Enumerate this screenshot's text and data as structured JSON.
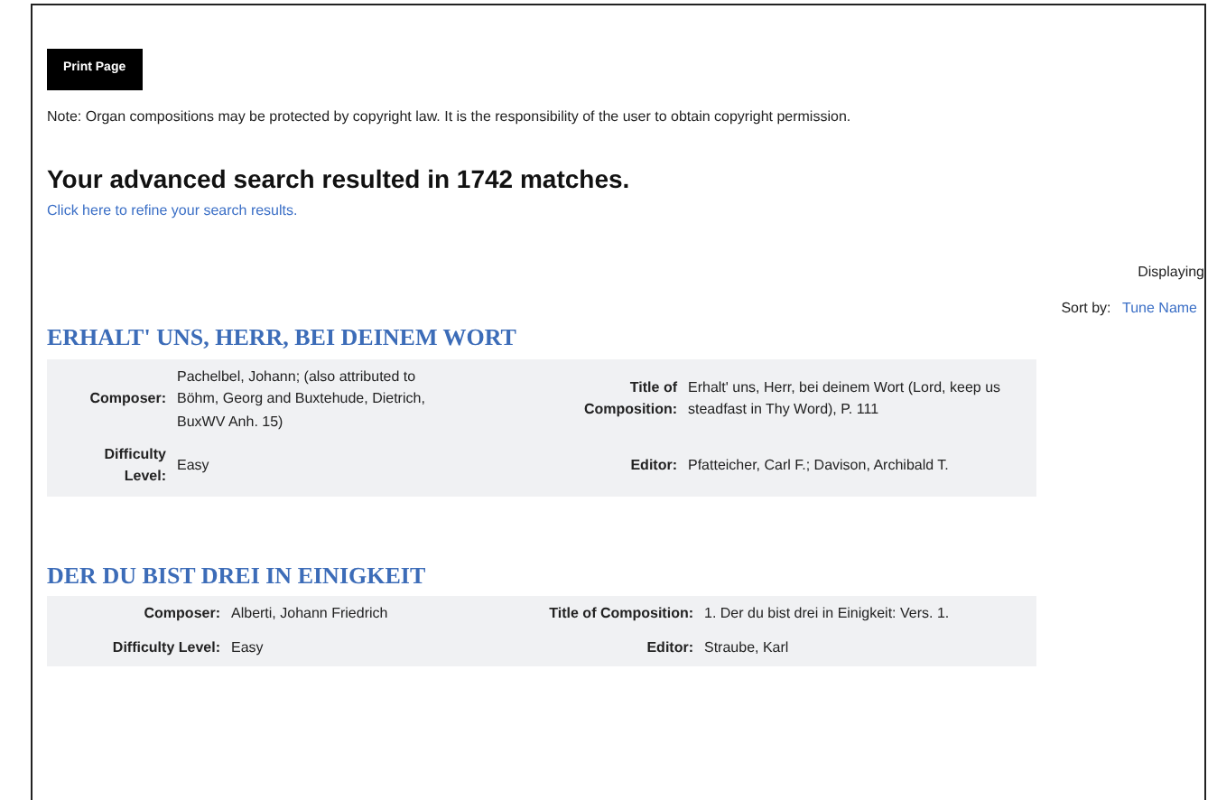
{
  "print_button": "Print Page",
  "note": "Note: Organ compositions may be protected by copyright law. It is the responsibility of the user to obtain copyright permission.",
  "results_heading": "Your advanced search resulted in 1742 matches.",
  "refine_link": "Click here to refine your search results.",
  "displaying": "Displaying",
  "sort": {
    "label": "Sort by:",
    "value": "Tune Name"
  },
  "results": [
    {
      "title": "ERHALT' UNS, HERR, BEI DEINEM WORT",
      "fields": [
        {
          "label": "Composer:",
          "value": "Pachelbel, Johann; (also attributed to Böhm, Georg and Buxtehude, Dietrich, BuxWV Anh. 15)"
        },
        {
          "label": "Title of Composition:",
          "value": "Erhalt' uns, Herr, bei deinem Wort (Lord, keep us steadfast in Thy Word), P. 111"
        },
        {
          "label": "Difficulty Level:",
          "value": "Easy"
        },
        {
          "label": "Editor:",
          "value": "Pfatteicher, Carl F.; Davison, Archibald T."
        }
      ]
    },
    {
      "title": "DER DU BIST DREI IN EINIGKEIT",
      "fields": [
        {
          "label": "Composer:",
          "value": "Alberti, Johann Friedrich"
        },
        {
          "label": "Title of Composition:",
          "value": "1. Der du bist drei in Einigkeit: Vers. 1."
        },
        {
          "label": "Difficulty Level:",
          "value": "Easy"
        },
        {
          "label": "Editor:",
          "value": "Straube, Karl"
        }
      ]
    }
  ]
}
